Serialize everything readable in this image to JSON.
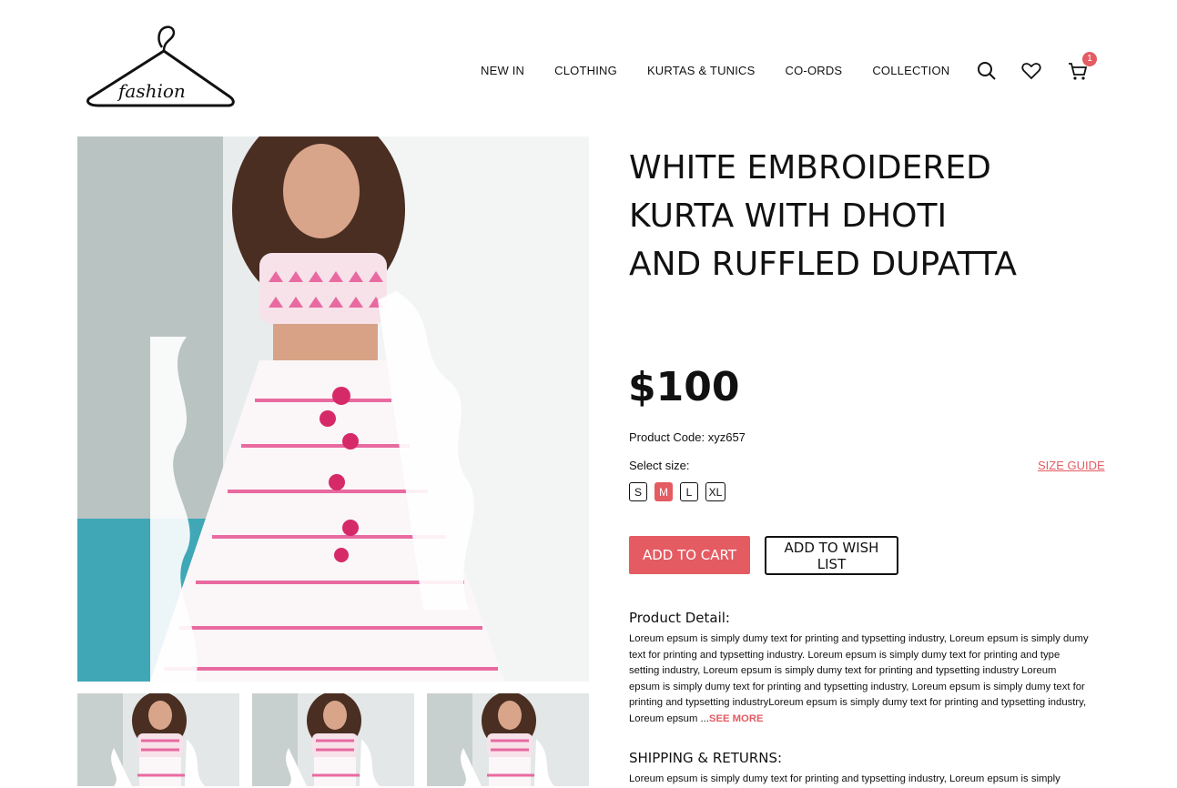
{
  "brand": {
    "logo_text": "fashion"
  },
  "nav": {
    "items": [
      {
        "label": "NEW IN"
      },
      {
        "label": "CLOTHING"
      },
      {
        "label": "KURTAS & TUNICS"
      },
      {
        "label": "CO-ORDS"
      },
      {
        "label": "COLLECTION"
      }
    ]
  },
  "header_icons": {
    "search": "search-icon",
    "wishlist": "heart-icon",
    "cart": "cart-icon",
    "cart_count": "1"
  },
  "product": {
    "title_lines": [
      "WHITE EMBROIDERED",
      "KURTA WITH DHOTI",
      "AND RUFFLED DUPATTA"
    ],
    "price": "$100",
    "code": "Product Code: xyz657",
    "select_size_label": "Select size:",
    "size_guide": "SIZE GUIDE",
    "sizes": [
      "S",
      "M",
      "L",
      "XL"
    ],
    "selected_size": "M",
    "add_to_cart": "ADD TO CART",
    "add_to_wishlist": "ADD TO WISH LIST",
    "detail_heading": "Product Detail:",
    "detail_text": "Loreum epsum is simply dumy text for printing and typsetting industry, Loreum epsum is simply dumy text for printing and typsetting industry. Loreum epsum is simply dumy text for printing and type setting industry, Loreum epsum is simply dumy text for printing and typsetting industry Loreum epsum is simply dumy text for printing and typsetting industry, Loreum epsum is simply dumy text for printing and typsetting industryLoreum epsum is simply dumy text for printing and typsetting industry, Loreum epsum ...",
    "see_more": "SEE MORE",
    "shipping_heading": "SHIPPING & RETURNS:",
    "shipping_text": "Loreum epsum is simply dumy text for printing and typsetting industry, Loreum epsum is simply"
  },
  "colors": {
    "accent": "#e45b62",
    "text": "#111111",
    "background": "#ffffff"
  }
}
